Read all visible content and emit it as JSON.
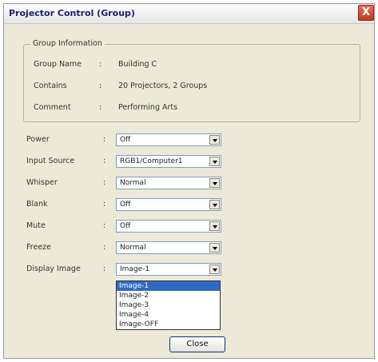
{
  "window": {
    "title": "Projector Control (Group)",
    "close_glyph": "X"
  },
  "group_info": {
    "legend": "Group Information",
    "rows": [
      {
        "label": "Group Name",
        "sep": ":",
        "value": "Building C"
      },
      {
        "label": "Contains",
        "sep": ":",
        "value": "20 Projectors, 2 Groups"
      },
      {
        "label": "Comment",
        "sep": ":",
        "value": "Performing Arts"
      }
    ]
  },
  "fields": [
    {
      "label": "Power",
      "sep": ":",
      "value": "Off"
    },
    {
      "label": "Input Source",
      "sep": ":",
      "value": "RGB1/Computer1"
    },
    {
      "label": "Whisper",
      "sep": ":",
      "value": "Normal"
    },
    {
      "label": "Blank",
      "sep": ":",
      "value": "Off"
    },
    {
      "label": "Mute",
      "sep": ":",
      "value": "Off"
    },
    {
      "label": "Freeze",
      "sep": ":",
      "value": "Normal"
    },
    {
      "label": "Display Image",
      "sep": ":",
      "value": "Image-1"
    }
  ],
  "display_image_options": [
    "Image-1",
    "Image-2",
    "Image-3",
    "Image-4",
    "Image-OFF"
  ],
  "display_image_highlighted": "Image-1",
  "buttons": {
    "close_label": "Close"
  }
}
